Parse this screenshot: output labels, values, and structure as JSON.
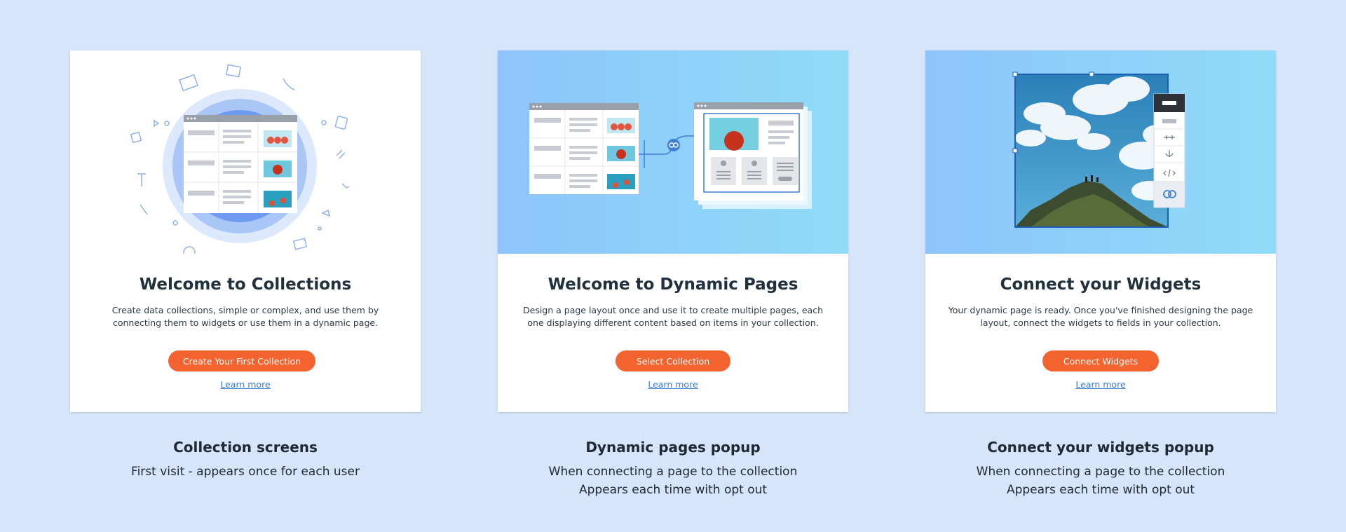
{
  "colors": {
    "page_background": "#d6e5fa",
    "accent_button": "#f36330",
    "link": "#3b7ad1",
    "illustration_blue": "#8ec4fa"
  },
  "cards": [
    {
      "title": "Welcome to Collections",
      "description": "Create data collections, simple or complex, and use them by connecting them to widgets or use them in a dynamic page.",
      "button_label": "Create Your First Collection",
      "learn_more": "Learn more",
      "caption_title": "Collection screens",
      "caption_lines": [
        "First visit - appears once for each user"
      ]
    },
    {
      "title": "Welcome to Dynamic Pages",
      "description": "Design a page layout once and use it to create multiple pages, each one displaying different content based on items in your collection.",
      "button_label": "Select Collection",
      "learn_more": "Learn more",
      "caption_title": "Dynamic pages popup",
      "caption_lines": [
        "When connecting a page to the collection",
        "Appears each time with opt out"
      ]
    },
    {
      "title": "Connect your Widgets",
      "description": "Your dynamic page is ready. Once you've finished designing the page layout, connect the widgets to fields in your collection.",
      "button_label": "Connect Widgets",
      "learn_more": "Learn more",
      "caption_title": "Connect your widgets popup",
      "caption_lines": [
        "When connecting a page to the collection",
        "Appears each time with opt out"
      ]
    }
  ]
}
